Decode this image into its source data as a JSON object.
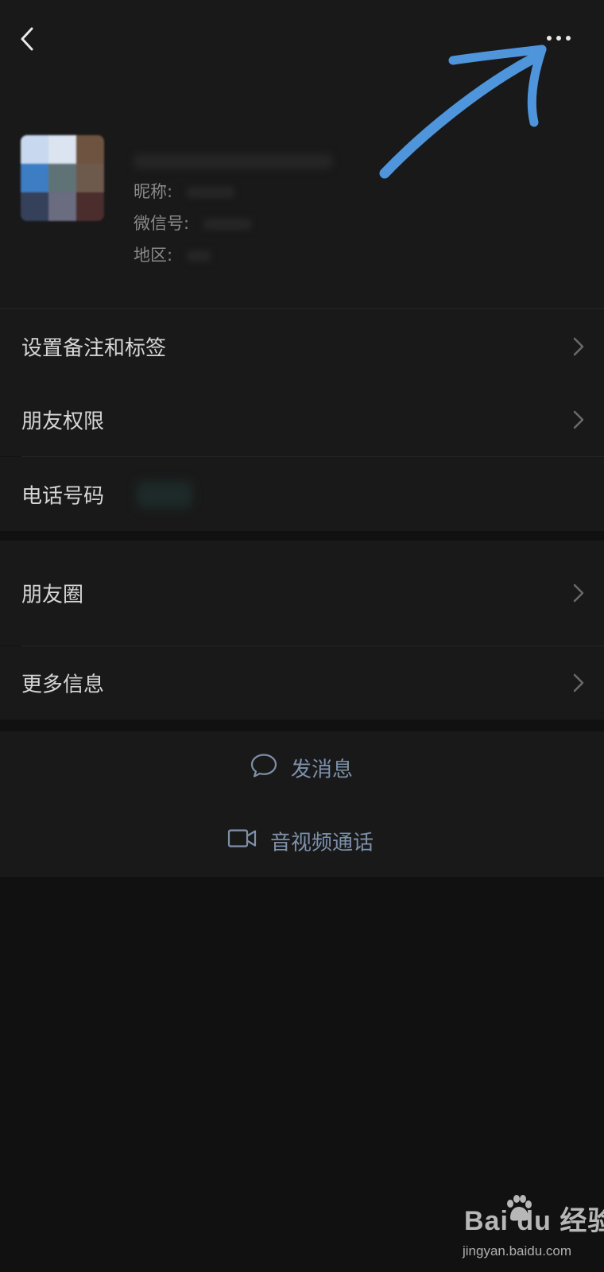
{
  "header": {
    "back_icon": "chevron-left-icon",
    "more_icon": "more-dots-icon"
  },
  "profile": {
    "nickname_label": "昵称:",
    "wechat_id_label": "微信号:",
    "region_label": "地区:"
  },
  "annotation": {
    "color": "#4f95dc",
    "type": "hand-drawn arrow pointing to more button"
  },
  "menu_group_1": [
    {
      "label": "设置备注和标签",
      "has_chevron": true
    },
    {
      "label": "朋友权限",
      "has_chevron": true
    },
    {
      "label": "电话号码",
      "has_chevron": false
    }
  ],
  "menu_group_2": [
    {
      "label": "朋友圈",
      "has_chevron": true
    },
    {
      "label": "更多信息",
      "has_chevron": true
    }
  ],
  "actions": {
    "message": {
      "label": "发消息",
      "icon": "chat-bubble-icon"
    },
    "call": {
      "label": "音视频通话",
      "icon": "video-camera-icon"
    }
  },
  "watermark": {
    "logo": "Bai du 经验",
    "url": "jingyan.baidu.com"
  },
  "colors": {
    "background": "#111111",
    "card": "#191919",
    "action_text": "#7d90aa"
  }
}
